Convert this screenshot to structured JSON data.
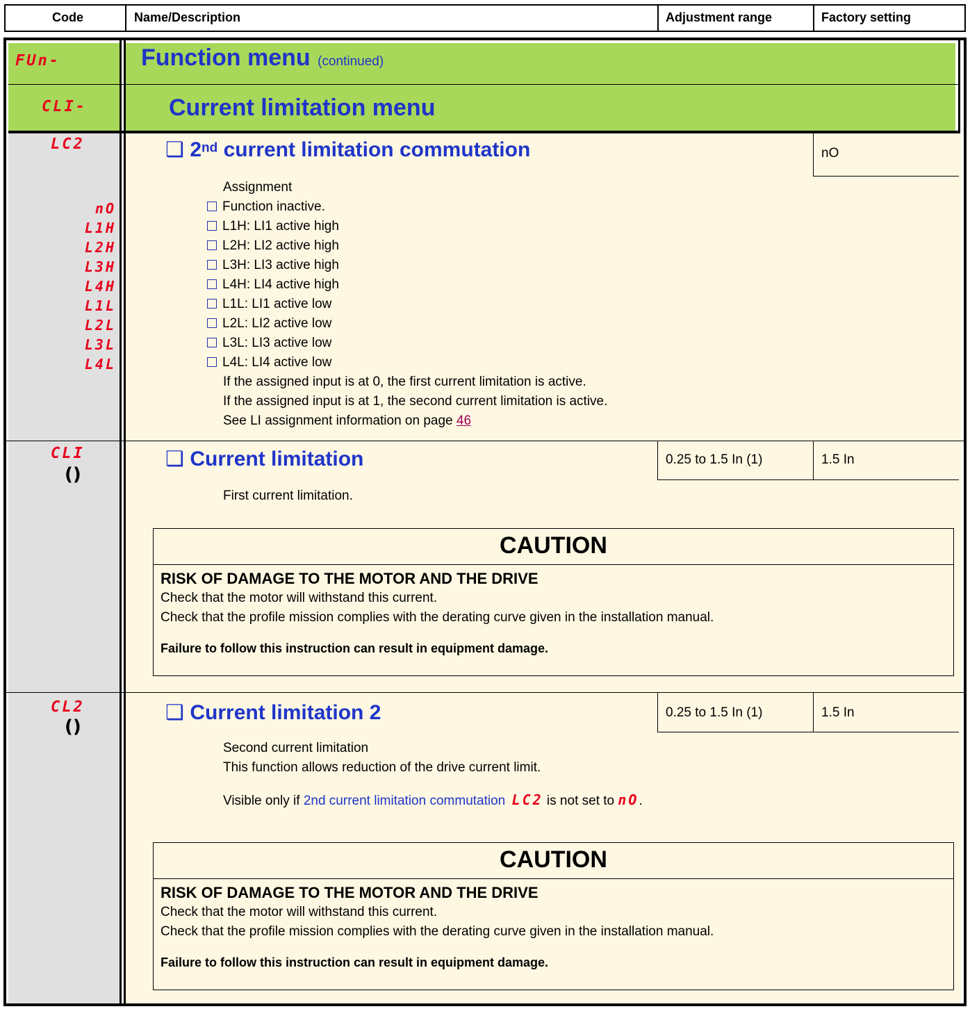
{
  "header": {
    "code": "Code",
    "name": "Name/Description",
    "range": "Adjustment range",
    "factory": "Factory setting"
  },
  "fun_row": {
    "code": "FUn-",
    "title": "Function menu",
    "suffix": "(continued)"
  },
  "cli_row": {
    "code": "CLI-",
    "title": "Current limitation menu"
  },
  "lc2": {
    "code": "LC2",
    "title_ordinal": "2",
    "title_sup": "nd",
    "title_rest": " current limitation commutation",
    "factory": "nO",
    "assignment_label": "Assignment",
    "options": [
      {
        "code": "nO",
        "text": "Function inactive."
      },
      {
        "code": "L1H",
        "text": "L1H: LI1 active high"
      },
      {
        "code": "L2H",
        "text": "L2H: LI2 active high"
      },
      {
        "code": "L3H",
        "text": "L3H: LI3 active high"
      },
      {
        "code": "L4H",
        "text": "L4H: LI4 active high"
      },
      {
        "code": "L1L",
        "text": "L1L: LI1 active low"
      },
      {
        "code": "L2L",
        "text": "L2L: LI2 active low"
      },
      {
        "code": "L3L",
        "text": "L3L: LI3 active low"
      },
      {
        "code": "L4L",
        "text": "L4L: LI4 active low"
      }
    ],
    "note1": "If the assigned input is at 0, the first current limitation is active.",
    "note2": "If the assigned input is at 1, the second current limitation is active.",
    "note3": "See LI assignment information on page ",
    "page_link": "46"
  },
  "cli": {
    "code": "CLI",
    "title": "Current limitation",
    "range": "0.25 to 1.5 In (1)",
    "factory": "1.5 In",
    "desc": "First current limitation."
  },
  "cl2": {
    "code": "CL2",
    "title": "Current limitation 2",
    "range": "0.25 to 1.5 In (1)",
    "factory": "1.5 In",
    "desc1": "Second current limitation",
    "desc2": "This function allows reduction of the drive current limit.",
    "visible_pre": "Visible only if ",
    "visible_link": "2nd current limitation commutation",
    "visible_code": "LC2",
    "visible_mid": " is not set to ",
    "visible_val": "nO",
    "visible_end": "."
  },
  "caution": {
    "title": "CAUTION",
    "risk": "RISK OF DAMAGE TO THE MOTOR AND THE DRIVE",
    "line1": "Check that the motor will withstand this current.",
    "line2": "Check that the profile mission complies with the derating curve given in the installation manual.",
    "failure": "Failure to follow this instruction can result in equipment damage."
  },
  "icons": {
    "checkbox": "checkbox-icon",
    "adjust": "adjust-in-motion-icon"
  },
  "colors": {
    "green": "#a8d85a",
    "cream": "#fef7e2",
    "gray": "#e0e0e0",
    "blue": "#1f35c8",
    "red": "#e8001c"
  }
}
